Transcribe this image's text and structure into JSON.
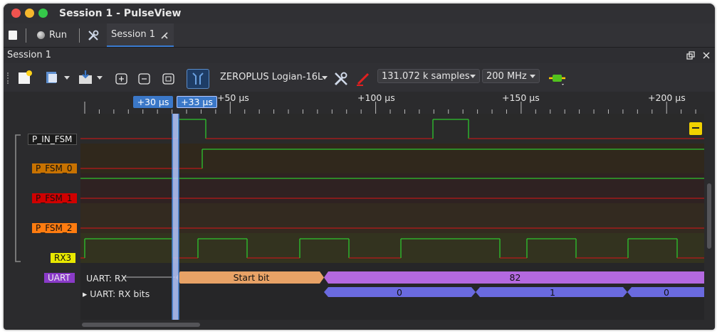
{
  "window": {
    "title": "Session 1 - PulseView"
  },
  "main_toolbar": {
    "run_label": "Run",
    "tab_label": "Session 1"
  },
  "session_bar": {
    "title": "Session 1"
  },
  "session_toolbar": {
    "device": "ZEROPLUS Logian-16L",
    "samples": "131.072 k samples",
    "samplerate": "200 MHz"
  },
  "ruler": {
    "labels": [
      "+50 µs",
      "+100 µs",
      "+150 µs",
      "+200 µs"
    ],
    "cursor_left": "+30 µs",
    "cursor_right": "+33 µs"
  },
  "channels": [
    {
      "name": "P_IN_FSM",
      "color": "#1e1e1e"
    },
    {
      "name": "P_FSM_0",
      "color": "#c87200"
    },
    {
      "name": "P_FSM_1",
      "color": "#d00000"
    },
    {
      "name": "P_FSM_2",
      "color": "#ff8000"
    },
    {
      "name": "RX3",
      "color": "#e8e800"
    }
  ],
  "decoder": {
    "name": "UART",
    "color": "#8a3bc8",
    "rows": [
      {
        "label": "UART: RX",
        "annotations": [
          "Start bit",
          "82"
        ]
      },
      {
        "label": "UART: RX bits",
        "annotations": [
          "0",
          "1",
          "0"
        ]
      }
    ]
  },
  "colors": {
    "high": "#2ec62e",
    "low": "#b81a1a",
    "cursor": "#b5c8ff",
    "start_bit": "#e8a266",
    "data_byte": "#b469e0",
    "bits": "#6a6adf"
  }
}
